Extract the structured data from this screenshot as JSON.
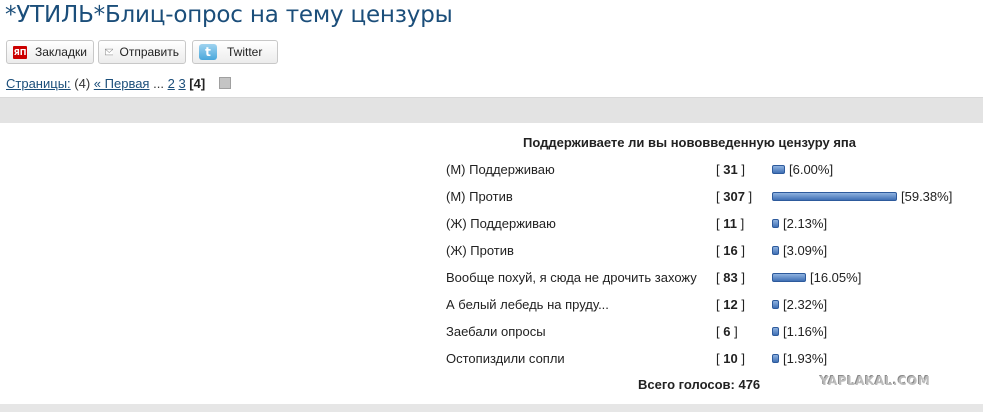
{
  "topic": {
    "title": "*УТИЛЬ*Блиц-опрос на тему цензуры"
  },
  "share": {
    "bookmarks_icon_text": "ЯП",
    "bookmarks_label": "Закладки",
    "send_label": "Отправить",
    "twitter_icon_text": "t",
    "twitter_label": "Twitter"
  },
  "pagination": {
    "label": "Страницы:",
    "count": "(4)",
    "first": "« Первая",
    "ellipsis": "...",
    "page2": "2",
    "page3": "3",
    "current": "[4]"
  },
  "poll": {
    "question": "Поддерживаете ли вы нововведенную цензуру япа",
    "options": [
      {
        "label": "(М) Поддерживаю",
        "votes": 31,
        "percent": 6.0,
        "percent_text": "[6.00%]"
      },
      {
        "label": "(М) Против",
        "votes": 307,
        "percent": 59.38,
        "percent_text": "[59.38%]"
      },
      {
        "label": "(Ж) Поддерживаю",
        "votes": 11,
        "percent": 2.13,
        "percent_text": "[2.13%]"
      },
      {
        "label": "(Ж) Против",
        "votes": 16,
        "percent": 3.09,
        "percent_text": "[3.09%]"
      },
      {
        "label": "Вообще похуй, я сюда не дрочить захожу",
        "votes": 83,
        "percent": 16.05,
        "percent_text": "[16.05%]"
      },
      {
        "label": "А белый лебедь на пруду...",
        "votes": 12,
        "percent": 2.32,
        "percent_text": "[2.32%]"
      },
      {
        "label": "Заебали опросы",
        "votes": 6,
        "percent": 1.16,
        "percent_text": "[1.16%]"
      },
      {
        "label": "Остопиздили сопли",
        "votes": 10,
        "percent": 1.93,
        "percent_text": "[1.93%]"
      }
    ],
    "total_text": "Всего голосов: 476"
  },
  "watermark": "YAPLAKAL.COM",
  "colors": {
    "link": "#1b4e7a",
    "bar": "#3f6fb4",
    "strip": "#e3e3e3"
  }
}
